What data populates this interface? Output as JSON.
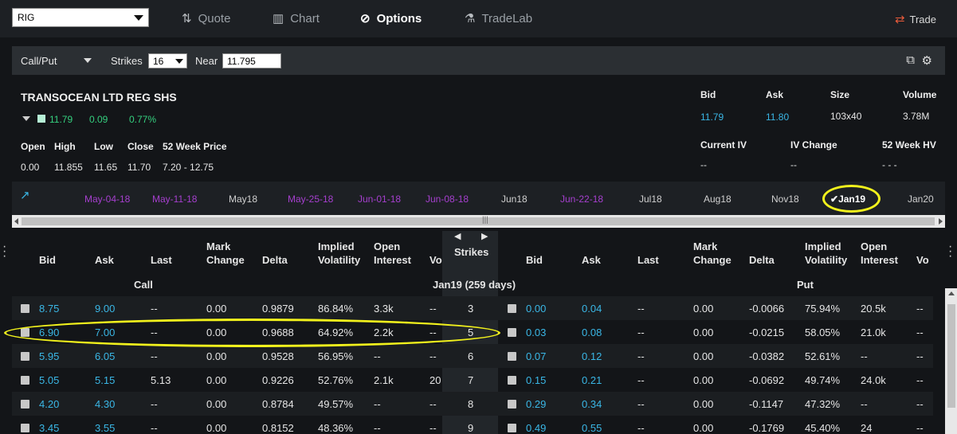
{
  "symbol": "RIG",
  "nav": {
    "quote": "Quote",
    "chart": "Chart",
    "options": "Options",
    "tradelab": "TradeLab",
    "trade": "Trade"
  },
  "toolbar": {
    "type": "Call/Put",
    "strikes_label": "Strikes",
    "strikes_value": "16",
    "near_label": "Near",
    "near_value": "11.795"
  },
  "quote": {
    "name": "TRANSOCEAN LTD REG SHS",
    "last": "11.79",
    "change": "0.09",
    "change_pct": "0.77%",
    "labels": {
      "bid": "Bid",
      "ask": "Ask",
      "size": "Size",
      "volume": "Volume",
      "open": "Open",
      "high": "High",
      "low": "Low",
      "close": "Close",
      "week52": "52 Week Price",
      "iv": "Current IV",
      "ivchange": "IV Change",
      "hv": "52 Week HV"
    },
    "bid": "11.79",
    "ask": "11.80",
    "size": "103x40",
    "volume": "3.78M",
    "open": "0.00",
    "high": "11.855",
    "low": "11.65",
    "close": "11.70",
    "week52": "7.20 - 12.75",
    "iv": "--",
    "ivchange": "--",
    "hv": "- - -"
  },
  "expirations": [
    {
      "label": "May-04-18",
      "weekly": true
    },
    {
      "label": "May-11-18",
      "weekly": true
    },
    {
      "label": "May18",
      "weekly": false
    },
    {
      "label": "May-25-18",
      "weekly": true
    },
    {
      "label": "Jun-01-18",
      "weekly": true
    },
    {
      "label": "Jun-08-18",
      "weekly": true
    },
    {
      "label": "Jun18",
      "weekly": false
    },
    {
      "label": "Jun-22-18",
      "weekly": true
    },
    {
      "label": "Jul18",
      "weekly": false
    },
    {
      "label": "Aug18",
      "weekly": false
    },
    {
      "label": "Nov18",
      "weekly": false
    },
    {
      "label": "Jan19",
      "weekly": false,
      "selected": true
    },
    {
      "label": "Jan20",
      "weekly": false
    }
  ],
  "chain": {
    "call_label": "Call",
    "put_label": "Put",
    "expiry_label": "Jan19 (259 days)",
    "strikes_header": "Strikes",
    "call_headers": [
      "Bid",
      "Ask",
      "Last",
      "Mark\nChange",
      "Delta",
      "Implied\nVolatility",
      "Open\nInterest",
      "Vo"
    ],
    "put_headers": [
      "Bid",
      "Ask",
      "Last",
      "Mark\nChange",
      "Delta",
      "Implied\nVolatility",
      "Open\nInterest",
      "Vo"
    ],
    "rows": [
      {
        "strike": "3",
        "call": [
          "8.75",
          "9.00",
          "--",
          "0.00",
          "0.9879",
          "86.84%",
          "3.3k",
          "--"
        ],
        "put": [
          "0.00",
          "0.04",
          "--",
          "0.00",
          "-0.0066",
          "75.94%",
          "20.5k",
          "--"
        ]
      },
      {
        "strike": "5",
        "call": [
          "6.90",
          "7.00",
          "--",
          "0.00",
          "0.9688",
          "64.92%",
          "2.2k",
          "--"
        ],
        "put": [
          "0.03",
          "0.08",
          "--",
          "0.00",
          "-0.0215",
          "58.05%",
          "21.0k",
          "--"
        ]
      },
      {
        "strike": "6",
        "call": [
          "5.95",
          "6.05",
          "--",
          "0.00",
          "0.9528",
          "56.95%",
          "--",
          "--"
        ],
        "put": [
          "0.07",
          "0.12",
          "--",
          "0.00",
          "-0.0382",
          "52.61%",
          "--",
          "--"
        ]
      },
      {
        "strike": "7",
        "call": [
          "5.05",
          "5.15",
          "5.13",
          "0.00",
          "0.9226",
          "52.76%",
          "2.1k",
          "20"
        ],
        "put": [
          "0.15",
          "0.21",
          "--",
          "0.00",
          "-0.0692",
          "49.74%",
          "24.0k",
          "--"
        ]
      },
      {
        "strike": "8",
        "call": [
          "4.20",
          "4.30",
          "--",
          "0.00",
          "0.8784",
          "49.57%",
          "--",
          "--"
        ],
        "put": [
          "0.29",
          "0.34",
          "--",
          "0.00",
          "-0.1147",
          "47.32%",
          "--",
          "--"
        ]
      },
      {
        "strike": "9",
        "call": [
          "3.45",
          "3.55",
          "--",
          "0.00",
          "0.8152",
          "48.36%",
          "--",
          "--"
        ],
        "put": [
          "0.49",
          "0.55",
          "--",
          "0.00",
          "-0.1769",
          "45.40%",
          "24",
          "--"
        ]
      }
    ]
  },
  "colors": {
    "accent_cyan": "#3ab7e6",
    "positive": "#35d07f",
    "weekly": "#a63fcf",
    "highlight": "#f2f21c"
  }
}
